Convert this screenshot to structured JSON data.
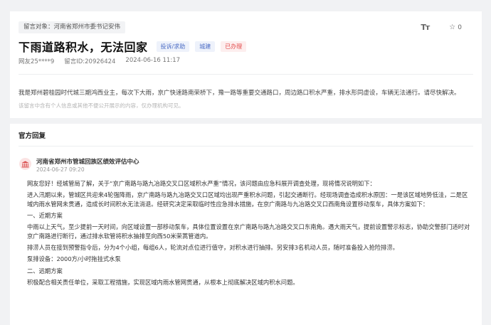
{
  "message": {
    "target_label": "留言对象：",
    "target_value": "河南省郑州市委书记安伟",
    "title": "下雨道路积水，无法回家",
    "tags": {
      "category": "投诉/求助",
      "area": "城建",
      "status": "已办理"
    },
    "user": "网友25****9",
    "msg_id": "留言ID:20926424",
    "datetime": "2024-06-16 11:17",
    "content": "我是郑州碧桂园时代城三期鸿西业主，每次下大雨，京广快速路南荣桥下，豫一路等重要交通路口，周边路口积水严重，排水形同虚设，车辆无法通行。请尽快解决。",
    "notice": "该留言中含有个人信息或其他不便公开展示的内容，仅办理机构可见。",
    "font_tool": "Tт",
    "favorite_count": "0"
  },
  "reply": {
    "section_title": "官方回复",
    "org_name": "河南省郑州市管城回族区绩效评估中心",
    "date": "2024-06-27 09:20",
    "paragraphs": [
      "网友您好！经城管局了解，关于“京广南路与路九冶路交叉口区域积水严重”情况，该问题由应急科展开调查处理，现将情况说明如下：",
      "进入汛期以来，管城区共迎来4轮强降雨，京广南路与路九冶路交叉口区域均出现严重积水问题，引起交通断行。经现场调查造成积水原因：一是该区域地势低洼，二是区域内雨水管网未贯通，造成长时间积水无法消退。经研究决定采取临时性应急排水措施，在京广南路与九冶路交叉口西南角设置移动泵车，具体方案如下：",
      "一、近期方案",
      "中雨以上天气，至少提前一天时间，向区域设置一部移动泵车，具体位置设置在京广南路与路九冶路交叉口东南角。遇大雨天气，提前设置警示标志，协助交警部门适时对京广南路进行断行，通过排水软管将积水抽排至向西50米荣蒿管道内。",
      "排涝人员在接到预警指令后，分为4个小组，每组6人，轮流对点位进行值守，对积水进行抽排。另安排3名机动人员，随时准备投入抢险排涝。",
      "泵排设备：2000方/小时拖挂式水泵",
      "二、远期方案",
      "积极配合相关责任单位，采取工程措施，实现区域内雨水管网贯通，从根本上彻底解决区域内积水问题。"
    ]
  },
  "icons": {
    "font_size": "font-size-icon",
    "favorite": "star-icon",
    "org": "building-icon"
  },
  "colors": {
    "status_red": "#e24a4a",
    "tag_blue": "#4a6bc4"
  }
}
